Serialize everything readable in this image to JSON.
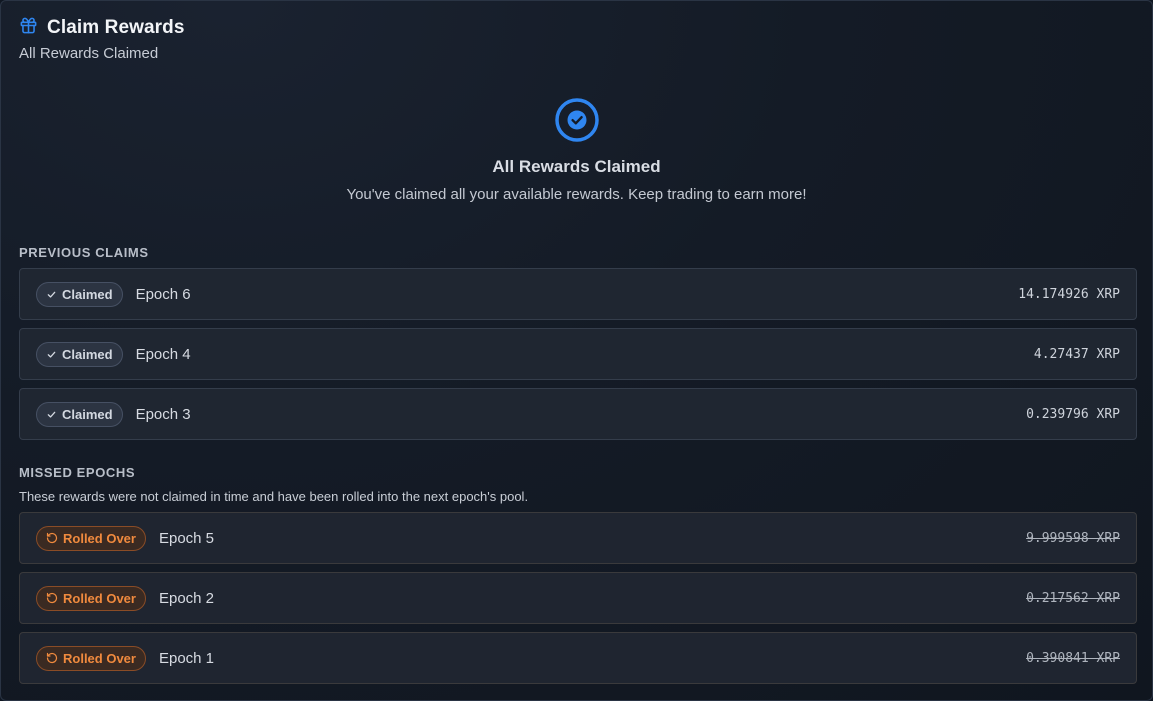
{
  "header": {
    "title": "Claim Rewards",
    "subtitle": "All Rewards Claimed",
    "icon": "gift-icon"
  },
  "hero": {
    "icon": "check-circle-icon",
    "title": "All Rewards Claimed",
    "description": "You've claimed all your available rewards. Keep trading to earn more!"
  },
  "previous_claims": {
    "label": "PREVIOUS CLAIMS",
    "items": [
      {
        "status": "Claimed",
        "epoch": "Epoch 6",
        "amount": "14.174926 XRP"
      },
      {
        "status": "Claimed",
        "epoch": "Epoch 4",
        "amount": "4.27437 XRP"
      },
      {
        "status": "Claimed",
        "epoch": "Epoch 3",
        "amount": "0.239796 XRP"
      }
    ]
  },
  "missed_epochs": {
    "label": "MISSED EPOCHS",
    "note": "These rewards were not claimed in time and have been rolled into the next epoch's pool.",
    "items": [
      {
        "status": "Rolled Over",
        "epoch": "Epoch 5",
        "amount": "9.999598 XRP"
      },
      {
        "status": "Rolled Over",
        "epoch": "Epoch 2",
        "amount": "0.217562 XRP"
      },
      {
        "status": "Rolled Over",
        "epoch": "Epoch 1",
        "amount": "0.390841 XRP"
      }
    ]
  },
  "colors": {
    "accent": "#2f86f0",
    "rolled_over": "#f08a3e",
    "background": "#141b26"
  }
}
